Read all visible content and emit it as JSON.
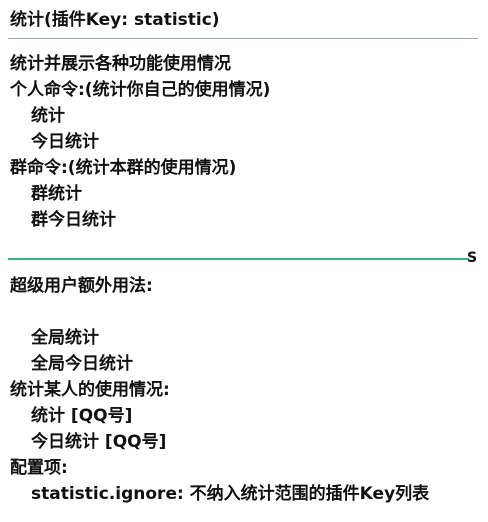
{
  "title": "统计(插件Key: statistic)",
  "section1": {
    "heading": "统计并展示各种功能使用情况",
    "personal_header": "个人命令:(统计你自己的使用情况)",
    "personal_cmds": [
      "统计",
      "今日统计"
    ],
    "group_header": "群命令:(统计本群的使用情况)",
    "group_cmds": [
      "群统计",
      "群今日统计"
    ]
  },
  "divider_marker": "S",
  "section2": {
    "heading": "超级用户额外用法:",
    "cmds": [
      "全局统计",
      "全局今日统计"
    ],
    "someone_header": "统计某人的使用情况:",
    "someone_cmds": [
      "统计 [QQ号]",
      "今日统计 [QQ号]"
    ],
    "config_header": "配置项:",
    "config_item": "statistic.ignore: 不纳入统计范围的插件Key列表"
  }
}
